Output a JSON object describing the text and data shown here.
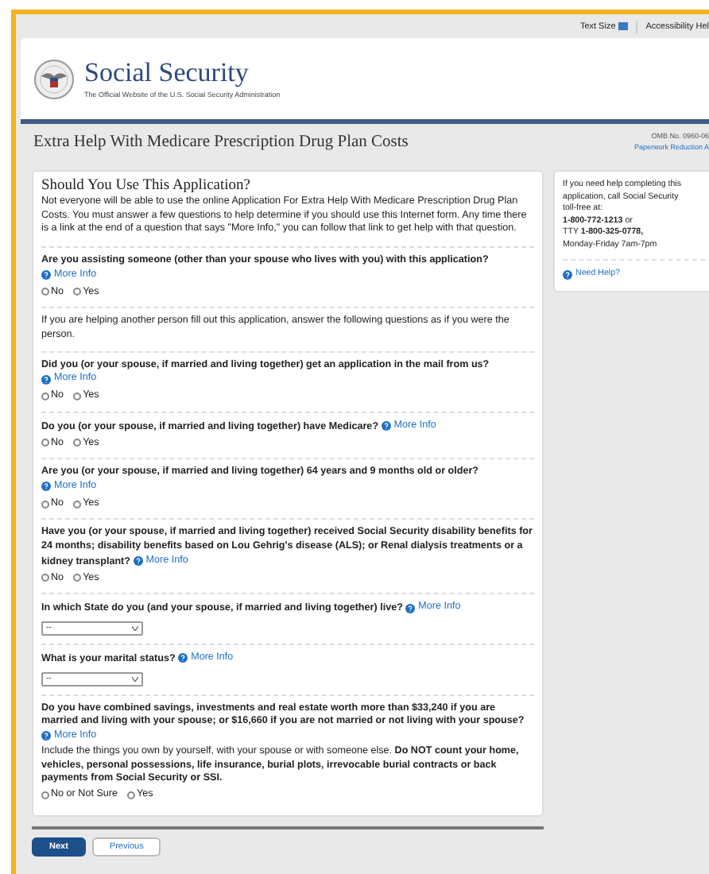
{
  "top_bar": {
    "text_size": "Text Size",
    "accessibility": "Accessibility Hel"
  },
  "header": {
    "title": "Social Security",
    "subtitle": "The Official Website of the U.S. Social Security Administration"
  },
  "page_title": "Extra Help With Medicare Prescription Drug Plan Costs",
  "omb": {
    "number": "OMB No. 0960-06",
    "link": "Paperwork Reduction A"
  },
  "intro": {
    "heading": "Should You Use This Application?",
    "text": "Not everyone will be able to use the online Application For Extra Help With Medicare Prescription Drug Plan Costs. You must answer a few questions to help determine if you should use this Internet form. Any time there is a link at the end of a question that says \"More Info,\" you can follow that link to get help with that question."
  },
  "questions": [
    {
      "kind": "radio",
      "text": "Are you assisting someone (other than your spouse who lives with you) with this application?",
      "more_info": "More Info",
      "options": [
        {
          "label": "No",
          "selected": false
        },
        {
          "label": "Yes",
          "selected": false
        }
      ]
    },
    {
      "kind": "note",
      "text": "If you are helping another person fill out this application, answer the following questions as if you were the person."
    },
    {
      "kind": "radio",
      "text": "Did you (or your spouse, if married and living together) get an application in the mail from us?",
      "more_info": "More Info",
      "options": [
        {
          "label": "No",
          "selected": false
        },
        {
          "label": "Yes",
          "selected": false
        }
      ]
    },
    {
      "kind": "radio",
      "text": "Do you (or your spouse, if married and living together) have Medicare?",
      "more_info": "More Info",
      "options": [
        {
          "label": "No",
          "selected": false
        },
        {
          "label": "Yes",
          "selected": false
        }
      ]
    },
    {
      "kind": "radio",
      "text": "Are you (or your spouse, if married and living together) 64 years and 9 months old or older?",
      "more_info": "More Info",
      "options": [
        {
          "label": "No",
          "selected": false
        },
        {
          "label": "Yes",
          "selected": false
        }
      ]
    },
    {
      "kind": "radio",
      "text": "Have you (or your spouse, if married and living together) received Social Security disability benefits for 24 months; disability benefits based on Lou Gehrig's disease (ALS); or Renal dialysis treatments or a kidney transplant?",
      "more_info": "More Info",
      "options": [
        {
          "label": "No",
          "selected": false
        },
        {
          "label": "Yes",
          "selected": false
        }
      ]
    },
    {
      "kind": "select",
      "text": "In which State do you (and your spouse, if married and living together) live?",
      "more_info": "More Info",
      "value": "--"
    },
    {
      "kind": "select",
      "text": "What is your marital status?",
      "more_info": "More Info",
      "value": "--"
    },
    {
      "kind": "radio",
      "text": "Do you have combined savings, investments and real estate worth more than $33,240 if you are married and living with your spouse; or $16,660 if you are not married or not living with your spouse?",
      "more_info": "More Info",
      "description": "Include the things you own by yourself, with your spouse or with someone else. **Do NOT count your home, vehicles, personal possessions, life insurance, burial plots, irrevocable burial contracts or back payments from Social Security or SSI.**",
      "options": [
        {
          "label": "No or Not Sure",
          "selected": false
        },
        {
          "label": "Yes",
          "selected": false
        }
      ]
    }
  ],
  "buttons": [
    {
      "label": "Next",
      "kind": "primary"
    },
    {
      "label": "Previous",
      "kind": "secondary"
    }
  ],
  "sidebar": {
    "lines": [
      "If you need help completing this",
      "application, call Social Security",
      "toll-free at:"
    ],
    "phone": "1-800-772-1213",
    "phone_suffix": "or",
    "tty_prefix": "TTY",
    "tty": "1-800-325-0778,",
    "hours": "Monday-Friday 7am-7pm",
    "help_link": "Need Help?"
  }
}
